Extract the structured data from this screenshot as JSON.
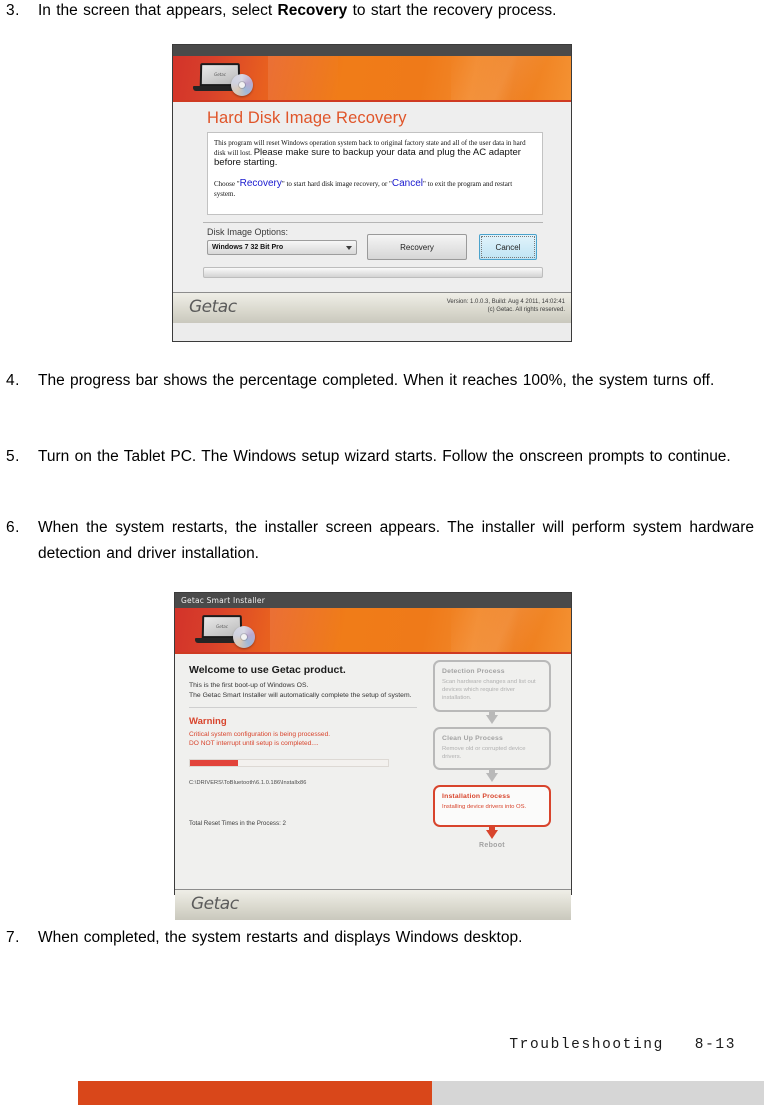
{
  "colors": {
    "accent_orange": "#d9471a",
    "footer_grey": "#d6d6d6",
    "recovery_title": "#e0552a",
    "warning_red": "#d8442c",
    "link_blue": "#1919cf"
  },
  "steps": {
    "s3": {
      "num": "3.",
      "pre": "In  the  screen  that  appears,  select  ",
      "bold": "Recovery",
      "post": "  to  start  the  recovery  process."
    },
    "s4": {
      "num": "4.",
      "text": "The  progress  bar  shows  the  percentage  completed.  When  it  reaches  100%,  the  system  turns  off."
    },
    "s5": {
      "num": "5.",
      "text": "Turn  on  the  Tablet  PC.  The  Windows  setup  wizard  starts.  Follow  the  onscreen  prompts  to  continue."
    },
    "s6": {
      "num": "6.",
      "text": "When  the  system  restarts,  the  installer  screen  appears.  The  installer  will  perform  system  hardware  detection  and  driver  installation."
    },
    "s7": {
      "num": "7.",
      "text": "When  completed,  the  system  restarts  and  displays  Windows  desktop."
    }
  },
  "recovery_dialog": {
    "laptop_logo_text": "Getac",
    "title": "Hard Disk Image Recovery",
    "paragraph1_small": "This program will reset Windows operation system back to original factory state and all of the user data in hard disk will lost.",
    "paragraph1_large": "Please make sure to backup your data and plug the AC adapter before starting.",
    "paragraph2_a": "Choose \"",
    "paragraph2_b": "Recovery",
    "paragraph2_c": "\" to start hard disk image recovery, or \"",
    "paragraph2_d": "Cancel",
    "paragraph2_e": "\" to exit the program and restart system.",
    "options_label": "Disk Image Options:",
    "combo_value": "Windows 7 32 Bit Pro",
    "combo_options": [
      "Windows 7 32 Bit Pro"
    ],
    "recovery_button": "Recovery",
    "cancel_button": "Cancel",
    "brand": "Getac",
    "version_line1": "Version: 1.0.0.3, Build: Aug  4 2011, 14:02:41",
    "version_line2": "(c) Getac.  All rights reserved."
  },
  "installer_dialog": {
    "window_title": "Getac Smart Installer",
    "laptop_logo_text": "Getac",
    "welcome": "Welcome to use Getac product.",
    "sub_line1": "This is the first boot-up of Windows OS.",
    "sub_line2": "The Getac Smart Installer will automatically complete the setup of system.",
    "warning_title": "Warning",
    "warning_line1": "Critical system configuration is being processed.",
    "warning_line2": "DO NOT interrupt until setup is completed....",
    "progress_percent": 24,
    "current_path": "C:\\DRIVERS\\ToBluetooth\\6.1.0.186\\Installx86",
    "reset_times": "Total Reset Times in the Process: 2",
    "processes": [
      {
        "title": "Detection Process",
        "desc": "Scan hardware changes and list out devices which require driver installation.",
        "active": false
      },
      {
        "title": "Clean Up Process",
        "desc": "Remove old or corrupted device drivers.",
        "active": false
      },
      {
        "title": "Installation Process",
        "desc": "Installing device drivers into OS.",
        "active": true
      }
    ],
    "reboot_label": "Reboot",
    "brand": "Getac"
  },
  "page_footer": {
    "text": "Troubleshooting   8-13"
  }
}
